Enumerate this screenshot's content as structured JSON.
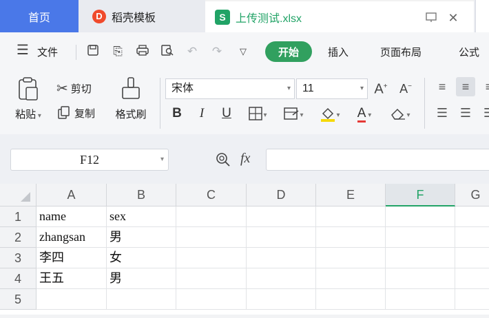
{
  "tabs": {
    "home": "首页",
    "templates": "稻壳模板",
    "templates_logo": "D",
    "file": "上传测试.xlsx",
    "file_logo": "S"
  },
  "menu": {
    "file": "文件",
    "start": "开始",
    "insert": "插入",
    "page_layout": "页面布局",
    "formula": "公式"
  },
  "ribbon": {
    "paste": "粘贴",
    "cut": "剪切",
    "copy": "复制",
    "format_painter": "格式刷",
    "font_name": "宋体",
    "font_size": "11",
    "bold": "B",
    "italic": "I",
    "underline": "U",
    "font_color_letter": "A"
  },
  "formula_bar": {
    "cell_ref": "F12",
    "fx": "fx",
    "value": ""
  },
  "sheet": {
    "columns": [
      "A",
      "B",
      "C",
      "D",
      "E",
      "F",
      "G"
    ],
    "selected_column": "F",
    "rows": [
      {
        "num": "1",
        "A": "name",
        "B": "sex"
      },
      {
        "num": "2",
        "A": "zhangsan",
        "B": "男"
      },
      {
        "num": "3",
        "A": "李四",
        "B": "女"
      },
      {
        "num": "4",
        "A": "王五",
        "B": "男"
      },
      {
        "num": "5",
        "A": "",
        "B": ""
      }
    ]
  },
  "colors": {
    "accent_green": "#21a366",
    "start_button": "#31a05f",
    "home_tab": "#4a78e8"
  }
}
